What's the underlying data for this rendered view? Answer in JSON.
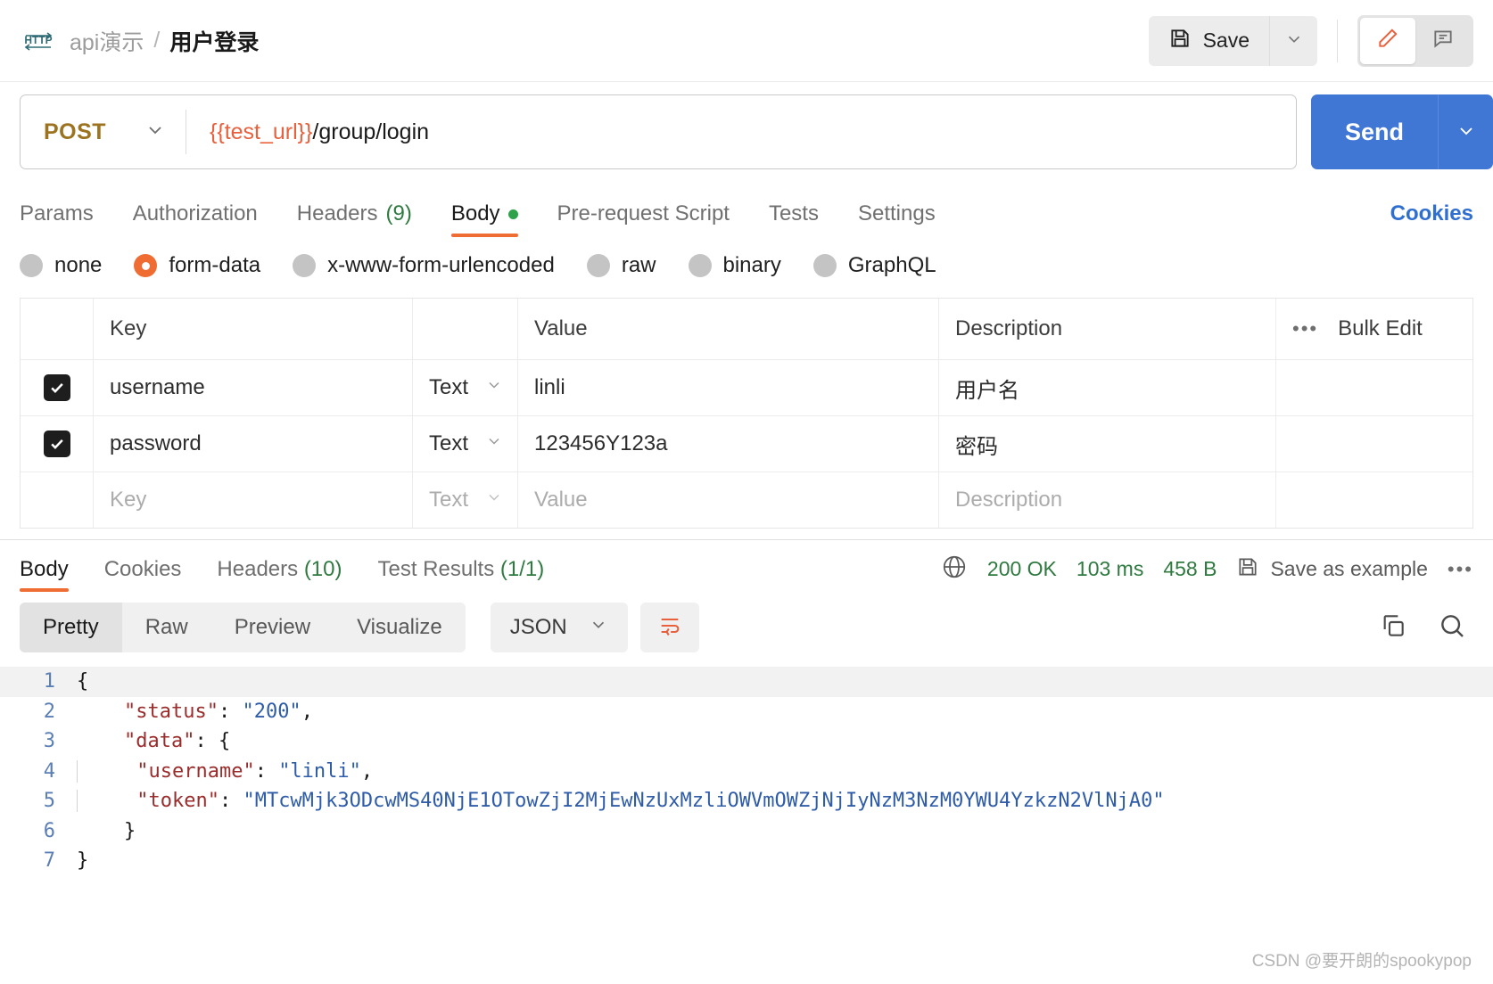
{
  "header": {
    "protocol_icon": "http-icon",
    "breadcrumb_collection": "api演示",
    "breadcrumb_separator": "/",
    "breadcrumb_request": "用户登录",
    "save_label": "Save",
    "save_icon": "floppy-disk-icon",
    "save_caret_icon": "chevron-down-icon",
    "edit_icon": "pencil-icon",
    "comment_icon": "comment-icon"
  },
  "request": {
    "method": "POST",
    "method_caret_icon": "chevron-down-icon",
    "url_variable": "{{test_url}}",
    "url_path": "/group/login",
    "send_label": "Send",
    "send_caret_icon": "chevron-down-icon",
    "tabs": [
      {
        "label": "Params",
        "count": "",
        "active": false,
        "dot": false
      },
      {
        "label": "Authorization",
        "count": "",
        "active": false,
        "dot": false
      },
      {
        "label": "Headers",
        "count": "(9)",
        "active": false,
        "dot": false
      },
      {
        "label": "Body",
        "count": "",
        "active": true,
        "dot": true
      },
      {
        "label": "Pre-request Script",
        "count": "",
        "active": false,
        "dot": false
      },
      {
        "label": "Tests",
        "count": "",
        "active": false,
        "dot": false
      },
      {
        "label": "Settings",
        "count": "",
        "active": false,
        "dot": false
      }
    ],
    "cookies_link": "Cookies",
    "body_types": [
      {
        "label": "none",
        "selected": false
      },
      {
        "label": "form-data",
        "selected": true
      },
      {
        "label": "x-www-form-urlencoded",
        "selected": false
      },
      {
        "label": "raw",
        "selected": false
      },
      {
        "label": "binary",
        "selected": false
      },
      {
        "label": "GraphQL",
        "selected": false
      }
    ],
    "table": {
      "headers": {
        "key": "Key",
        "value": "Value",
        "description": "Description",
        "bulk_edit": "Bulk Edit",
        "more_icon": "ellipsis-icon"
      },
      "rows": [
        {
          "checked": true,
          "key": "username",
          "type": "Text",
          "value": "linli",
          "description": "用户名"
        },
        {
          "checked": true,
          "key": "password",
          "type": "Text",
          "value": "123456Y123a",
          "description": "密码"
        }
      ],
      "placeholder_row": {
        "key": "Key",
        "type": "Text",
        "value": "Value",
        "description": "Description"
      }
    }
  },
  "response": {
    "tabs": [
      {
        "label": "Body",
        "count": "",
        "active": true
      },
      {
        "label": "Cookies",
        "count": "",
        "active": false
      },
      {
        "label": "Headers",
        "count": "(10)",
        "active": false
      },
      {
        "label": "Test Results",
        "count": "(1/1)",
        "active": false
      }
    ],
    "globe_icon": "globe-icon",
    "status": "200 OK",
    "time": "103 ms",
    "size": "458 B",
    "save_example_icon": "floppy-disk-icon",
    "save_example_label": "Save as example",
    "more_icon": "ellipsis-icon",
    "viewer": {
      "modes": [
        "Pretty",
        "Raw",
        "Preview",
        "Visualize"
      ],
      "active_mode": "Pretty",
      "format": "JSON",
      "format_caret_icon": "chevron-down-icon",
      "wrap_icon": "word-wrap-icon",
      "copy_icon": "copy-icon",
      "search_icon": "search-icon"
    },
    "body_lines": [
      {
        "n": "1",
        "indent": 0,
        "guide": false,
        "parts": [
          {
            "t": "punc",
            "s": "{"
          }
        ]
      },
      {
        "n": "2",
        "indent": 1,
        "guide": false,
        "parts": [
          {
            "t": "key",
            "s": "\"status\""
          },
          {
            "t": "punc",
            "s": ": "
          },
          {
            "t": "str",
            "s": "\"200\""
          },
          {
            "t": "punc",
            "s": ","
          }
        ]
      },
      {
        "n": "3",
        "indent": 1,
        "guide": false,
        "parts": [
          {
            "t": "key",
            "s": "\"data\""
          },
          {
            "t": "punc",
            "s": ": "
          },
          {
            "t": "punc",
            "s": "{"
          }
        ]
      },
      {
        "n": "4",
        "indent": 2,
        "guide": true,
        "parts": [
          {
            "t": "key",
            "s": "\"username\""
          },
          {
            "t": "punc",
            "s": ": "
          },
          {
            "t": "str",
            "s": "\"linli\""
          },
          {
            "t": "punc",
            "s": ","
          }
        ]
      },
      {
        "n": "5",
        "indent": 2,
        "guide": true,
        "parts": [
          {
            "t": "key",
            "s": "\"token\""
          },
          {
            "t": "punc",
            "s": ": "
          },
          {
            "t": "str",
            "s": "\"MTcwMjk3ODcwMS40NjE1OTowZjI2MjEwNzUxMzliOWVmOWZjNjIyNzM3NzM0YWU4YzkzN2VlNjA0\""
          }
        ]
      },
      {
        "n": "6",
        "indent": 1,
        "guide": false,
        "parts": [
          {
            "t": "punc",
            "s": "}"
          }
        ]
      },
      {
        "n": "7",
        "indent": 0,
        "guide": false,
        "parts": [
          {
            "t": "punc",
            "s": "}"
          }
        ]
      }
    ]
  },
  "watermark": "CSDN @要开朗的spookypop",
  "colors": {
    "accent_orange": "#ef6c33",
    "send_blue": "#4077d4",
    "status_green": "#2f7a40",
    "method_olive": "#9c7320",
    "link_blue": "#2f6fd0"
  }
}
